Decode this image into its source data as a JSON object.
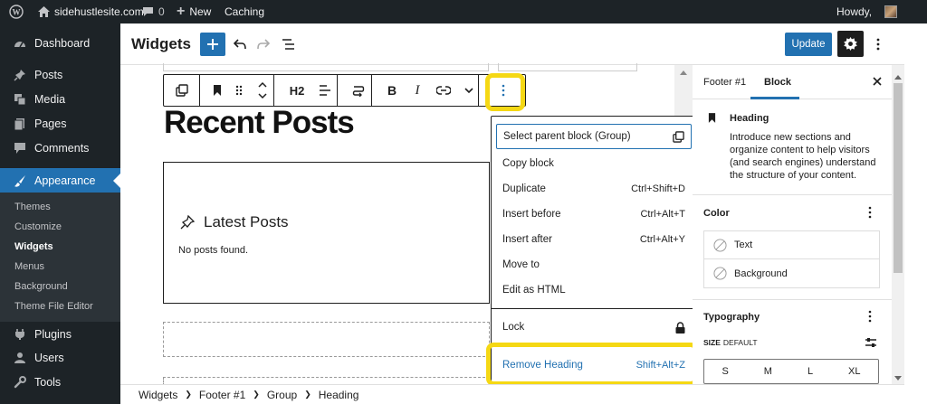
{
  "adminbar": {
    "site_name": "sidehustlesite.com",
    "comments_count": "0",
    "new_label": "New",
    "caching_label": "Caching",
    "howdy": "Howdy,"
  },
  "sidebar": {
    "items": [
      {
        "label": "Dashboard",
        "icon": "dashboard-icon"
      },
      {
        "label": "Posts",
        "icon": "pin-icon"
      },
      {
        "label": "Media",
        "icon": "media-icon"
      },
      {
        "label": "Pages",
        "icon": "pages-icon"
      },
      {
        "label": "Comments",
        "icon": "comment-icon"
      },
      {
        "label": "Appearance",
        "icon": "brush-icon"
      },
      {
        "label": "Plugins",
        "icon": "plugin-icon"
      },
      {
        "label": "Users",
        "icon": "user-icon"
      },
      {
        "label": "Tools",
        "icon": "wrench-icon"
      }
    ],
    "submenu": [
      "Themes",
      "Customize",
      "Widgets",
      "Menus",
      "Background",
      "Theme File Editor"
    ]
  },
  "editor": {
    "title": "Widgets",
    "update_label": "Update"
  },
  "block_toolbar": {
    "heading_level": "H2"
  },
  "canvas": {
    "heading": "Recent Posts",
    "latest_posts_title": "Latest Posts",
    "no_posts": "No posts found."
  },
  "context_menu": {
    "select_parent": "Select parent block (Group)",
    "items": [
      {
        "label": "Copy block",
        "shortcut": ""
      },
      {
        "label": "Duplicate",
        "shortcut": "Ctrl+Shift+D"
      },
      {
        "label": "Insert before",
        "shortcut": "Ctrl+Alt+T"
      },
      {
        "label": "Insert after",
        "shortcut": "Ctrl+Alt+Y"
      },
      {
        "label": "Move to",
        "shortcut": ""
      },
      {
        "label": "Edit as HTML",
        "shortcut": ""
      }
    ],
    "lock": "Lock",
    "remove": "Remove Heading",
    "remove_shortcut": "Shift+Alt+Z"
  },
  "inspector": {
    "tabs": [
      "Footer #1",
      "Block"
    ],
    "block_name": "Heading",
    "block_desc": "Introduce new sections and organize content to help visitors (and search engines) understand the structure of your content.",
    "color_title": "Color",
    "color_items": [
      "Text",
      "Background"
    ],
    "typography_title": "Typography",
    "size_label": "SIZE",
    "size_value": "DEFAULT",
    "sizes": [
      "S",
      "M",
      "L",
      "XL"
    ]
  },
  "breadcrumb": [
    "Widgets",
    "Footer #1",
    "Group",
    "Heading"
  ],
  "colors": {
    "accent": "#2271b1",
    "highlight": "#f5d814",
    "admin_dark": "#1d2327"
  }
}
